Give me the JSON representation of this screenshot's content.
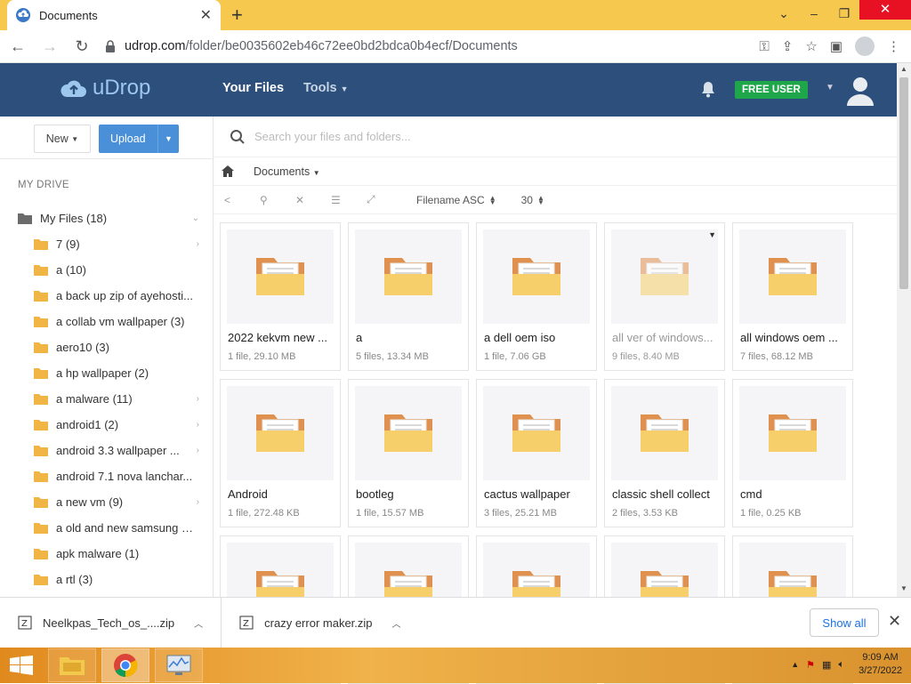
{
  "browser": {
    "tab_title": "Documents",
    "url_host": "udrop.com",
    "url_path": "/folder/be0035602eb46c72ee0bd2bdca0b4ecf/Documents"
  },
  "app": {
    "logo_text": "uDrop",
    "nav_your_files": "Your Files",
    "nav_tools": "Tools",
    "badge": "FREE USER",
    "colors": {
      "header": "#2c4f7c",
      "accent": "#4a90d9",
      "badge": "#1fa64a"
    }
  },
  "sidebar": {
    "new_label": "New",
    "upload_label": "Upload",
    "section_title": "MY DRIVE",
    "root": "My Files (18)",
    "items": [
      {
        "label": "7 (9)",
        "chev": true
      },
      {
        "label": "a (10)",
        "chev": false
      },
      {
        "label": "a back up zip of ayehosti...",
        "chev": false
      },
      {
        "label": "a collab vm wallpaper (3)",
        "chev": false
      },
      {
        "label": "aero10 (3)",
        "chev": false
      },
      {
        "label": "a hp wallpaper (2)",
        "chev": false
      },
      {
        "label": "a malware (11)",
        "chev": true
      },
      {
        "label": "android1 (2)",
        "chev": true
      },
      {
        "label": "android 3.3 wallpaper ...",
        "chev": true
      },
      {
        "label": "android 7.1 nova lanchar...",
        "chev": false
      },
      {
        "label": "a new vm (9)",
        "chev": true
      },
      {
        "label": "a old and new samsung d...",
        "chev": false
      },
      {
        "label": "apk malware (1)",
        "chev": false
      },
      {
        "label": "a rtl (3)",
        "chev": false
      }
    ]
  },
  "main": {
    "search_placeholder": "Search your files and folders...",
    "breadcrumb": "Documents",
    "sort_label": "Filename ASC",
    "per_page": "30",
    "files": [
      {
        "name": "2022 kekvm new ...",
        "meta": "1 file, 29.10 MB"
      },
      {
        "name": "a",
        "meta": "5 files, 13.34 MB"
      },
      {
        "name": "a dell oem iso",
        "meta": "1 file, 7.06 GB"
      },
      {
        "name": "all ver of windows...",
        "meta": "9 files, 8.40 MB"
      },
      {
        "name": "all windows oem ...",
        "meta": "7 files, 68.12 MB"
      },
      {
        "name": "Android",
        "meta": "1 file, 272.48 KB"
      },
      {
        "name": "bootleg",
        "meta": "1 file, 15.57 MB"
      },
      {
        "name": "cactus wallpaper",
        "meta": "3 files, 25.21 MB"
      },
      {
        "name": "classic shell collect",
        "meta": "2 files, 3.53 KB"
      },
      {
        "name": "cmd",
        "meta": "1 file, 0.25 KB"
      }
    ]
  },
  "downloads": {
    "items": [
      "Neelkpas_Tech_os_....zip",
      "crazy error  maker.zip"
    ],
    "show_all": "Show all"
  },
  "taskbar": {
    "time": "9:09 AM",
    "date": "3/27/2022"
  }
}
